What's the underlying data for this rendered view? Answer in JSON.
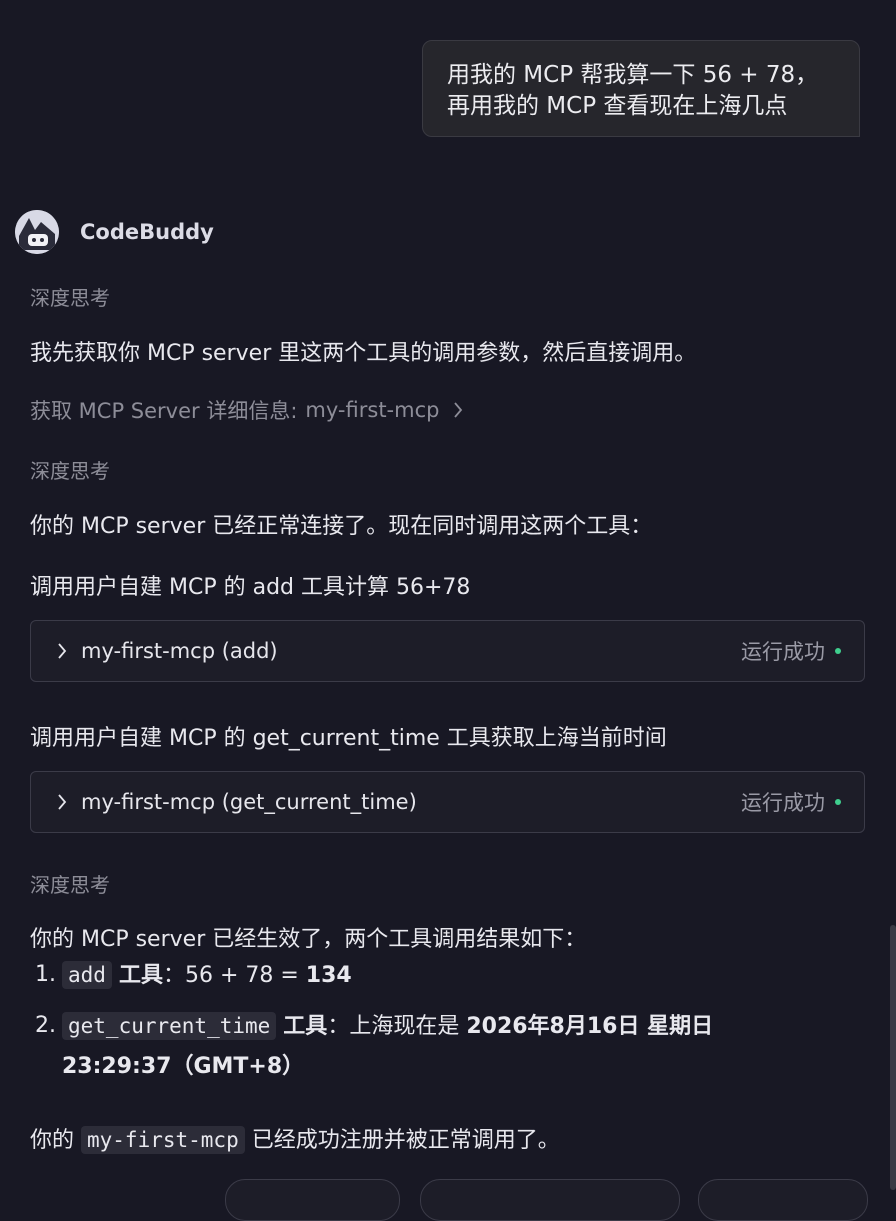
{
  "user_message": {
    "line1": "用我的 MCP 帮我算一下 56 + 78，",
    "line2": "再用我的 MCP 查看现在上海几点"
  },
  "assistant": {
    "name": "CodeBuddy",
    "thinking_label": "深度思考",
    "msg1": "我先获取你 MCP server 里这两个工具的调用参数，然后直接调用。",
    "server_info_label": "获取 MCP Server 详细信息:",
    "server_info_name": "my-first-mcp",
    "msg2": "你的 MCP server 已经正常连接了。现在同时调用这两个工具：",
    "call1_desc": "调用用户自建 MCP 的 add 工具计算 56+78",
    "tool1": {
      "name": "my-first-mcp (add)",
      "status": "运行成功",
      "status_color": "#3fcf8e"
    },
    "call2_desc": "调用用户自建 MCP 的 get_current_time 工具获取上海当前时间",
    "tool2": {
      "name": "my-first-mcp (get_current_time)",
      "status": "运行成功",
      "status_color": "#3fcf8e"
    },
    "msg3": "你的 MCP server 已经生效了，两个工具调用结果如下：",
    "results": [
      {
        "num": "1.",
        "code": "add",
        "label": "工具",
        "sep": "：",
        "plain": "56 + 78 = ",
        "bold": "134"
      },
      {
        "num": "2.",
        "code": "get_current_time",
        "label": "工具",
        "sep": "：",
        "plain": "上海现在是 ",
        "bold": "2026年8月16日 星期日",
        "bold2": "23:29:37（GMT+8）"
      }
    ],
    "final_pre": "你的 ",
    "final_code": "my-first-mcp",
    "final_post": " 已经成功注册并被正常调用了。"
  },
  "icons": {
    "avatar": "codebuddy-avatar-icon",
    "chevron": "chevron-right-icon",
    "status": "status-dot-icon"
  }
}
